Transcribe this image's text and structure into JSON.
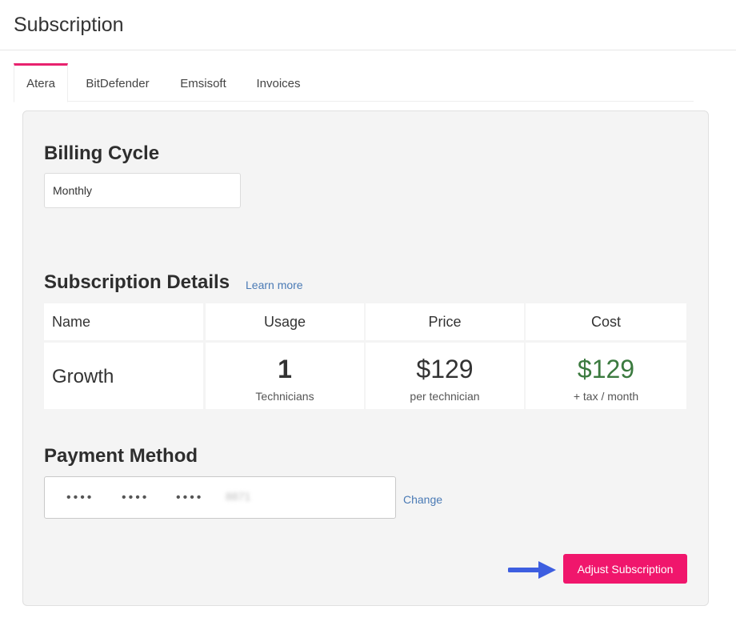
{
  "header": {
    "title": "Subscription"
  },
  "tabs": [
    {
      "label": "Atera",
      "active": true
    },
    {
      "label": "BitDefender",
      "active": false
    },
    {
      "label": "Emsisoft",
      "active": false
    },
    {
      "label": "Invoices",
      "active": false
    }
  ],
  "billing": {
    "title": "Billing Cycle",
    "value": "Monthly"
  },
  "details": {
    "title": "Subscription Details",
    "learn_more": "Learn more",
    "columns": [
      "Name",
      "Usage",
      "Price",
      "Cost"
    ],
    "row": {
      "name": "Growth",
      "usage_value": "1",
      "usage_unit": "Technicians",
      "price_value": "$129",
      "price_unit": "per technician",
      "cost_value": "$129",
      "cost_unit": "+ tax / month"
    }
  },
  "payment": {
    "title": "Payment Method",
    "masked_groups": [
      "••••",
      "••••",
      "••••"
    ],
    "last4": "8871",
    "change_label": "Change"
  },
  "actions": {
    "adjust_label": "Adjust Subscription"
  },
  "colors": {
    "accent": "#e8226e",
    "button": "#f0166c",
    "link": "#4a7ab5",
    "cost_green": "#3b7a3f",
    "arrow": "#3d5ee0"
  }
}
